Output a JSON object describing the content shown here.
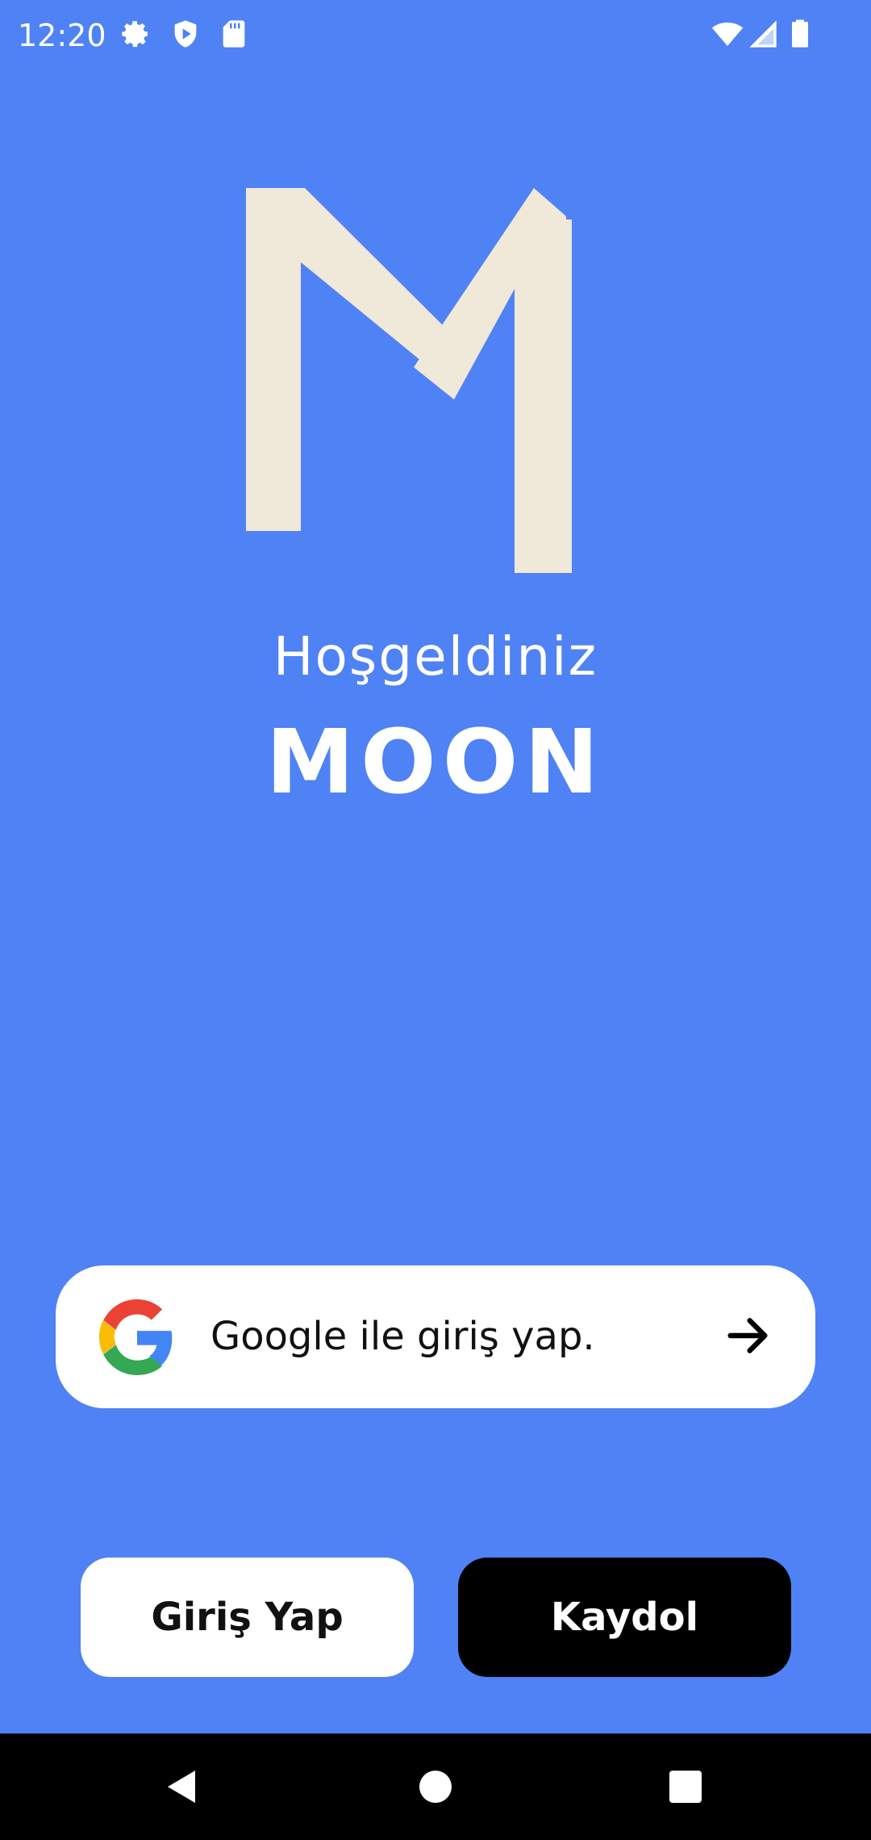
{
  "status_bar": {
    "time": "12:20",
    "icons_left": [
      "settings-icon",
      "shield-icon",
      "sd-card-icon"
    ],
    "icons_right": [
      "wifi-icon",
      "signal-icon",
      "battery-icon"
    ]
  },
  "logo": {
    "letter": "M",
    "color": "#f0e8d8"
  },
  "welcome": {
    "greeting": "Hoşgeldiniz",
    "app_name": "MOON"
  },
  "google_button": {
    "label": "Google ile giriş yap.",
    "icon": "google-icon",
    "trailing_icon": "arrow-right-icon"
  },
  "actions": {
    "login_label": "Giriş Yap",
    "register_label": "Kaydol"
  },
  "nav_bar": {
    "items": [
      "back-icon",
      "home-icon",
      "recents-icon"
    ]
  },
  "colors": {
    "background": "#4f82f4",
    "button_light": "#ffffff",
    "button_dark": "#000000"
  }
}
